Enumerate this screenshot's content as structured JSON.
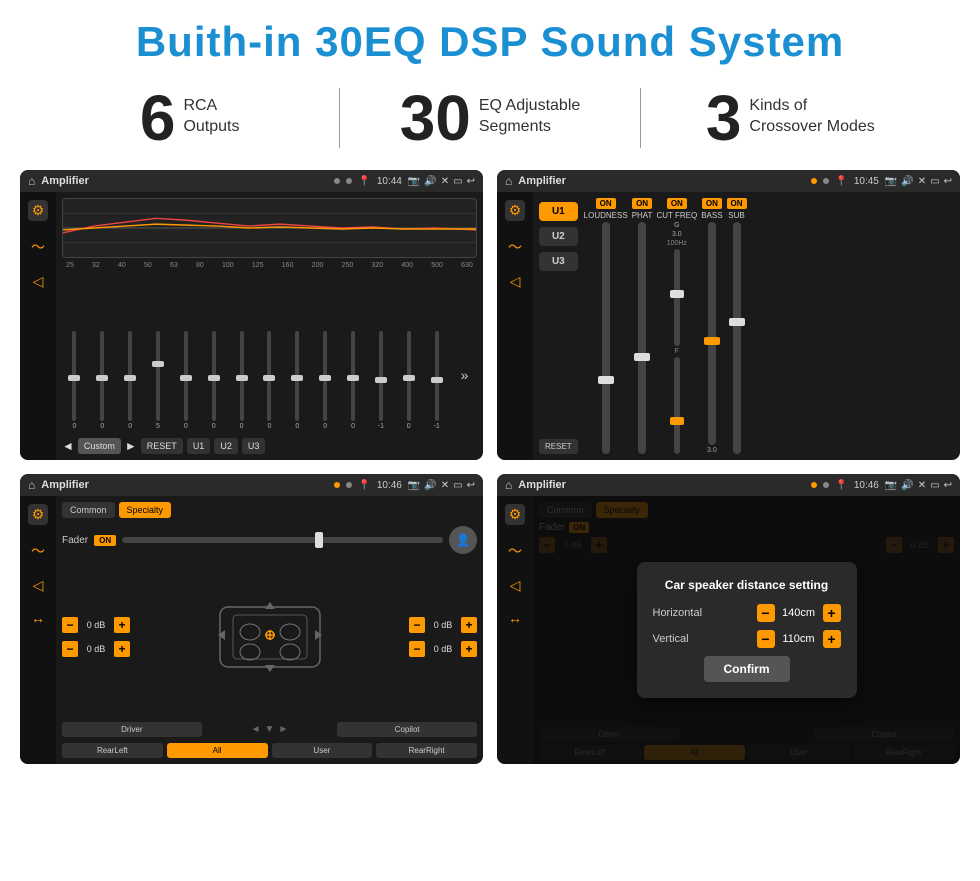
{
  "header": {
    "title": "Buith-in 30EQ DSP Sound System"
  },
  "stats": [
    {
      "number": "6",
      "label": "RCA\nOutputs"
    },
    {
      "number": "30",
      "label": "EQ Adjustable\nSegments"
    },
    {
      "number": "3",
      "label": "Kinds of\nCrossover Modes"
    }
  ],
  "screens": {
    "eq": {
      "title": "Amplifier",
      "time": "10:44",
      "frequencies": [
        "25",
        "32",
        "40",
        "50",
        "63",
        "80",
        "100",
        "125",
        "160",
        "200",
        "250",
        "320",
        "400",
        "500",
        "630"
      ],
      "values": [
        "0",
        "0",
        "0",
        "5",
        "0",
        "0",
        "0",
        "0",
        "0",
        "0",
        "0",
        "-1",
        "0",
        "-1"
      ],
      "presets": [
        "Custom",
        "RESET",
        "U1",
        "U2",
        "U3"
      ]
    },
    "amp": {
      "title": "Amplifier",
      "time": "10:45",
      "presets": [
        "U1",
        "U2",
        "U3"
      ],
      "controls": [
        "LOUDNESS",
        "PHAT",
        "CUT FREQ",
        "BASS",
        "SUB"
      ],
      "on_states": [
        true,
        true,
        true,
        true,
        true
      ]
    },
    "fader": {
      "title": "Amplifier",
      "time": "10:46",
      "tabs": [
        "Common",
        "Specialty"
      ],
      "fader_label": "Fader",
      "fader_on": "ON",
      "db_values": [
        "0 dB",
        "0 dB",
        "0 dB",
        "0 dB"
      ],
      "buttons": [
        "Driver",
        "Copilot",
        "RearLeft",
        "All",
        "User",
        "RearRight"
      ]
    },
    "dialog": {
      "title": "Amplifier",
      "time": "10:46",
      "tabs": [
        "Common",
        "Specialty"
      ],
      "dialog_title": "Car speaker distance setting",
      "horizontal_label": "Horizontal",
      "horizontal_value": "140cm",
      "vertical_label": "Vertical",
      "vertical_value": "110cm",
      "confirm_label": "Confirm",
      "buttons": [
        "Driver",
        "Copilot",
        "RearLeft",
        "All",
        "User",
        "RearRight"
      ]
    }
  },
  "colors": {
    "accent": "#f90",
    "brand_blue": "#1a8fd1",
    "bg_dark": "#1a1a1a",
    "bg_medium": "#2a2a2a"
  }
}
